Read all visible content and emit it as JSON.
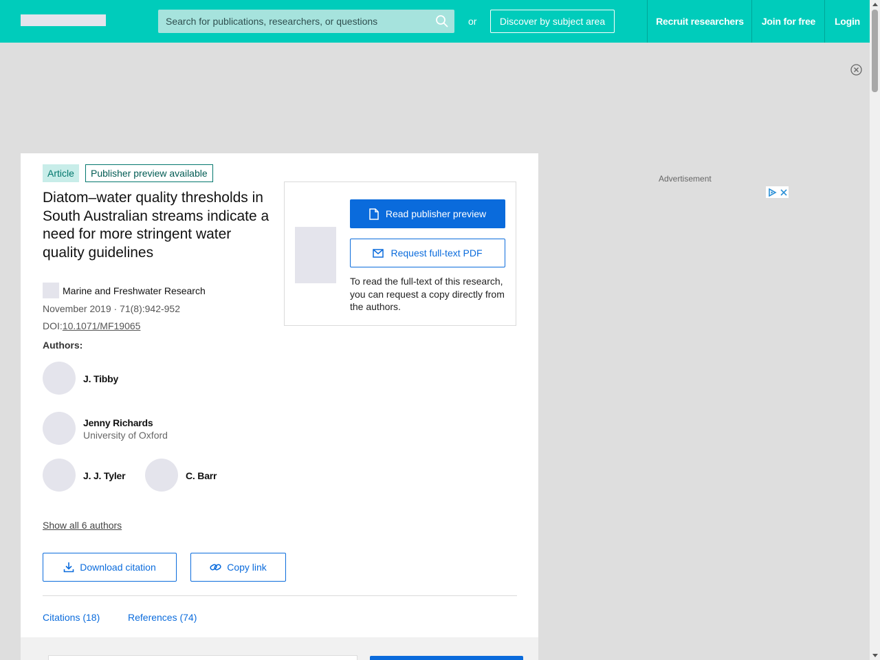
{
  "header": {
    "search_placeholder": "Search for publications, researchers, or questions",
    "or_text": "or",
    "discover_label": "Discover by subject area",
    "nav": {
      "recruit": "Recruit researchers",
      "join": "Join for free",
      "login": "Login"
    }
  },
  "article": {
    "type_badge": "Article",
    "preview_badge": "Publisher preview available",
    "title": "Diatom–water quality thresholds in South Australian streams indicate a need for more stringent water quality guidelines",
    "journal": "Marine and Freshwater Research",
    "date_volume": "November 2019 · 71(8):942-952",
    "doi_prefix": "DOI:",
    "doi": "10.1071/MF19065",
    "authors_label": "Authors:",
    "authors": [
      {
        "name": "J. Tibby",
        "affiliation": ""
      },
      {
        "name": "Jenny Richards",
        "affiliation": "University of Oxford"
      },
      {
        "name": "J. J. Tyler",
        "affiliation": ""
      },
      {
        "name": "C. Barr",
        "affiliation": ""
      }
    ],
    "show_all_authors": "Show all 6 authors",
    "download_citation": "Download citation",
    "copy_link": "Copy link",
    "tabs": {
      "citations": "Citations (18)",
      "references": "References (74)"
    }
  },
  "access": {
    "read_preview": "Read publisher preview",
    "request_pdf": "Request full-text PDF",
    "note": "To read the full-text of this research, you can request a copy directly from the authors."
  },
  "ad": {
    "label": "Advertisement"
  },
  "colors": {
    "header_bg": "#00ccbb",
    "primary_blue": "#0a6bdc",
    "badge_teal": "#00766c",
    "page_bg": "#dedede"
  }
}
